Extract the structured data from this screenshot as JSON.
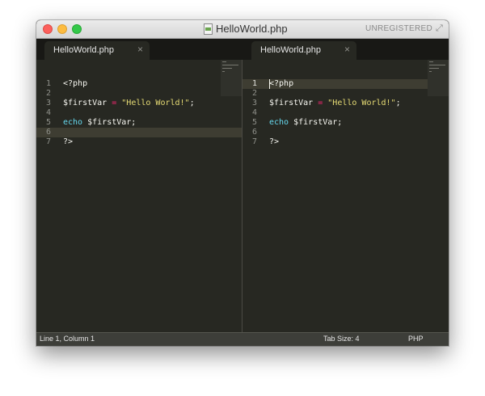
{
  "window": {
    "title": "HelloWorld.php",
    "registration": "UNREGISTERED"
  },
  "tabs": {
    "left": {
      "label": "HelloWorld.php",
      "close": "×"
    },
    "right": {
      "label": "HelloWorld.php",
      "close": "×"
    }
  },
  "editor": {
    "line_numbers": [
      "1",
      "2",
      "3",
      "4",
      "5",
      "6",
      "7"
    ],
    "lines": {
      "l1": "<?php",
      "l3_var": "$firstVar",
      "l3_op": "=",
      "l3_str": "\"Hello World!\"",
      "l3_end": ";",
      "l5_kw": "echo",
      "l5_rest": "$firstVar;",
      "l7": "?>"
    },
    "active_line_right": "1",
    "highlight_line_left": "6"
  },
  "statusbar": {
    "position": "Line 1, Column 1",
    "tab_size": "Tab Size: 4",
    "syntax": "PHP"
  },
  "colors": {
    "background": "#272822",
    "keyword": "#66d9ef",
    "operator": "#f92672",
    "string": "#e6db74",
    "foreground": "#f8f8f2"
  }
}
